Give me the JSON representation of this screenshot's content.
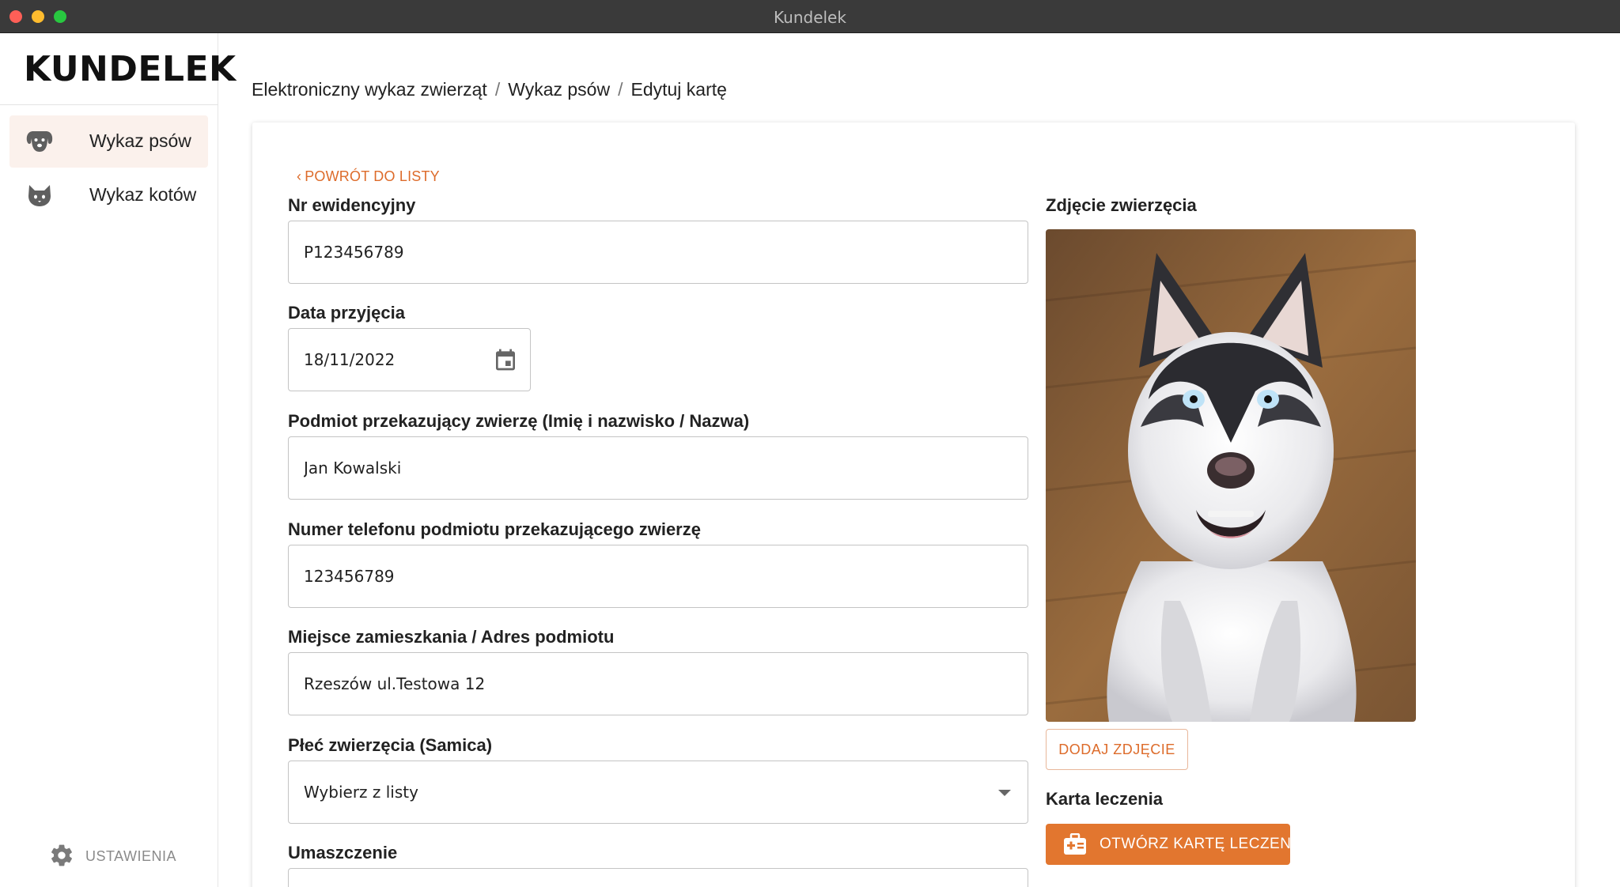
{
  "window": {
    "title": "Kundelek"
  },
  "sidebar": {
    "logo": "KUNDELEK",
    "items": [
      {
        "label": "Wykaz psów",
        "icon": "dog-icon",
        "active": true
      },
      {
        "label": "Wykaz kotów",
        "icon": "cat-icon",
        "active": false
      }
    ],
    "settings_label": "USTAWIENIA"
  },
  "breadcrumb": [
    "Elektroniczny wykaz zwierząt",
    "Wykaz psów",
    "Edytuj kartę"
  ],
  "form": {
    "back_label": "POWRÓT DO LISTY",
    "fields": {
      "nr_ewidencyjny": {
        "label": "Nr ewidencyjny",
        "value": "P123456789"
      },
      "data_przyjecia": {
        "label": "Data przyjęcia",
        "value": "18/11/2022"
      },
      "podmiot": {
        "label": "Podmiot przekazujący zwierzę (Imię i nazwisko / Nazwa)",
        "value": "Jan Kowalski"
      },
      "telefon": {
        "label": "Numer telefonu podmiotu przekazującego zwierzę",
        "value": "123456789"
      },
      "adres": {
        "label": "Miejsce zamieszkania / Adres podmiotu",
        "value": "Rzeszów ul.Testowa 12"
      },
      "plec": {
        "label": "Płeć zwierzęcia (Samica)",
        "value": "Wybierz z listy"
      },
      "umaszczenie": {
        "label": "Umaszczenie",
        "value": ""
      }
    }
  },
  "photo_panel": {
    "label": "Zdjęcie zwierzęcia",
    "add_photo_label": "DODAJ ZDJĘCIE",
    "treatment_label": "Karta leczenia",
    "open_treatment_label": "OTWÓRZ KARTĘ LECZENIA"
  },
  "colors": {
    "accent": "#e2762f",
    "active_bg": "#fbf1ec",
    "titlebar": "#3a3a3a"
  }
}
